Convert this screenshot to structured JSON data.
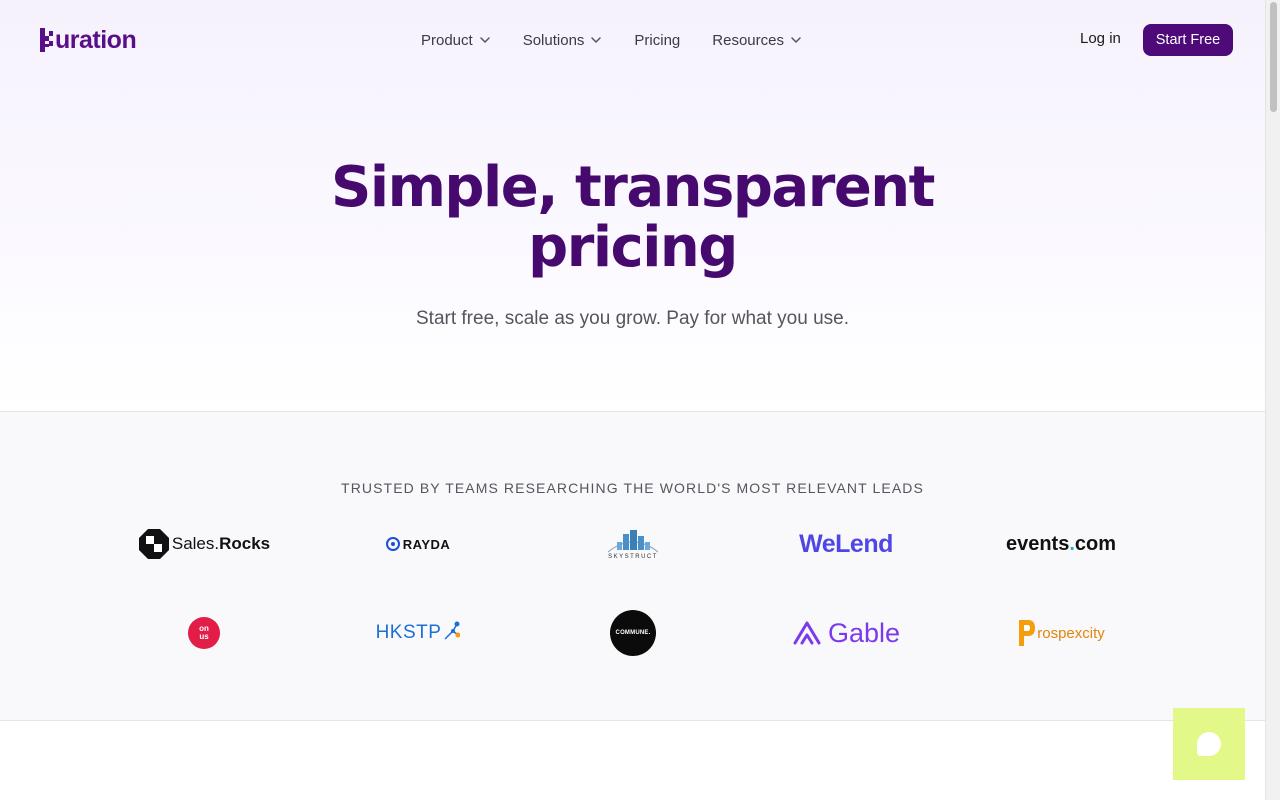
{
  "nav": {
    "logo_text": "uration",
    "menu": [
      {
        "label": "Product",
        "has_dropdown": true
      },
      {
        "label": "Solutions",
        "has_dropdown": true
      },
      {
        "label": "Pricing",
        "has_dropdown": false
      },
      {
        "label": "Resources",
        "has_dropdown": true
      }
    ],
    "login_label": "Log in",
    "start_label": "Start Free"
  },
  "hero": {
    "title_line1": "Simple, transparent",
    "title_line2": "pricing",
    "subtitle": "Start free, scale as you grow. Pay for what you use."
  },
  "trusted": {
    "heading": "TRUSTED BY TEAMS RESEARCHING THE WORLD'S MOST RELEVANT LEADS",
    "logos": [
      {
        "name": "Sales.Rocks",
        "text_a": "Sales.",
        "text_b": "Rocks"
      },
      {
        "name": "RAYDA",
        "text": "RAYDA"
      },
      {
        "name": "SKYSTRUCT",
        "text": "SKYSTRUCT"
      },
      {
        "name": "WeLend",
        "text": "WeLend"
      },
      {
        "name": "events.com",
        "text_a": "events",
        "text_b": ".",
        "text_c": "com"
      },
      {
        "name": "onus",
        "text": "on us"
      },
      {
        "name": "HKSTP",
        "text": "HKSTP"
      },
      {
        "name": "COMMUNE",
        "text": "COMMUNE."
      },
      {
        "name": "Gable",
        "text": "Gable"
      },
      {
        "name": "Prospexcity",
        "text": "rospexcity"
      }
    ]
  },
  "colors": {
    "brand": "#4d0a78",
    "title": "#46096e",
    "chat_bg": "#e2f98a"
  },
  "icons": {
    "dropdown": "chevron-down-icon",
    "chat": "chat-bubble-icon"
  }
}
